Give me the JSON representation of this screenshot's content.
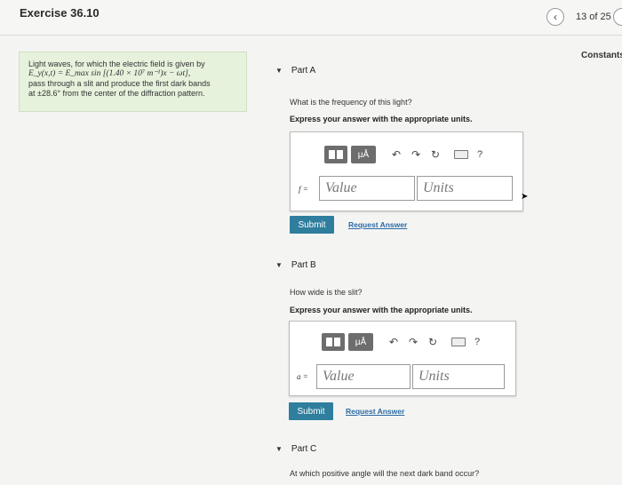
{
  "header": {
    "title": "Exercise 36.10",
    "pager": "13 of 25",
    "prev_icon": "‹",
    "constants": "Constants"
  },
  "problem": {
    "line1": "Light waves, for which the electric field is given by",
    "line2": "E_y(x,t) = E_max sin [(1.40 × 10⁷ m⁻¹)x − ωt],",
    "line3": "pass through a slit and produce the first dark bands",
    "line4": "at ±28.6° from the center of the diffraction pattern."
  },
  "toolbar": {
    "mu_label": "μÅ",
    "undo_icon": "↶",
    "redo_icon": "↷",
    "reset_icon": "↻",
    "help_label": "?"
  },
  "partA": {
    "title": "Part A",
    "question": "What is the frequency of this light?",
    "instruction": "Express your answer with the appropriate units.",
    "var_label": "f =",
    "value_placeholder": "Value",
    "units_placeholder": "Units",
    "submit_label": "Submit",
    "request_label": "Request Answer"
  },
  "partB": {
    "title": "Part B",
    "question": "How wide is the slit?",
    "instruction": "Express your answer with the appropriate units.",
    "var_label": "a =",
    "value_placeholder": "Value",
    "units_placeholder": "Units",
    "submit_label": "Submit",
    "request_label": "Request Answer"
  },
  "partC": {
    "title": "Part C",
    "question": "At which positive angle will the next dark band occur?"
  }
}
